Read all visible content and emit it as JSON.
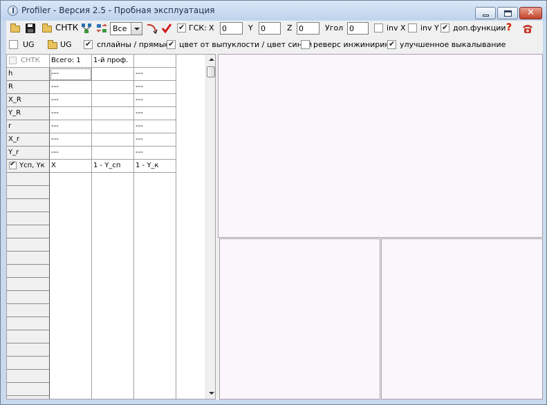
{
  "window": {
    "title": "Profiler - Версия 2.5 - Пробная эксплуатация",
    "close_symbol": "✕"
  },
  "toolbar1": {
    "chtk_label": "СНТК",
    "select_value": "Все",
    "gsk_label": "ГСК:",
    "gsk_checked": true,
    "x_label": "X",
    "x_value": "0",
    "y_label": "Y",
    "y_value": "0",
    "z_label": "Z",
    "z_value": "0",
    "angle_label": "Угол",
    "angle_value": "0",
    "invx_label": "inv X",
    "invx_checked": false,
    "invy_label": "inv Y",
    "invy_checked": false,
    "extra_label": "доп.функции",
    "extra_checked": true,
    "help_symbol": "?"
  },
  "toolbar2": {
    "ug_check_label": "UG",
    "ug_checked": false,
    "ug_button_label": "UG",
    "splines_label": "сплайны / прямые",
    "splines_checked": true,
    "color_label": "цвет от выпуклости / цвет синий",
    "color_checked": true,
    "reverse_label": "реверс инжиниринг",
    "reverse_checked": false,
    "improved_label": "улучшенное выкалывание",
    "improved_checked": true
  },
  "grid": {
    "header": {
      "chtk": "СНТК",
      "col1": "Всего: 1",
      "col2": "1-й проф.",
      "col3": ""
    },
    "rows": [
      {
        "name": "h",
        "c1": "---",
        "c2": "",
        "c3": "---"
      },
      {
        "name": "R",
        "c1": "---",
        "c2": "",
        "c3": "---"
      },
      {
        "name": "X_R",
        "c1": "---",
        "c2": "",
        "c3": "---"
      },
      {
        "name": "Y_R",
        "c1": "---",
        "c2": "",
        "c3": "---"
      },
      {
        "name": "r",
        "c1": "---",
        "c2": "",
        "c3": "---"
      },
      {
        "name": "X_r",
        "c1": "---",
        "c2": "",
        "c3": "---"
      },
      {
        "name": "Y_r",
        "c1": "---",
        "c2": "",
        "c3": "---"
      }
    ],
    "ycp_row": {
      "name": "Yсп, Yк",
      "c1": "X",
      "c2": "1 - Y_сп",
      "c3": "1 - Y_к",
      "checked": true
    }
  }
}
